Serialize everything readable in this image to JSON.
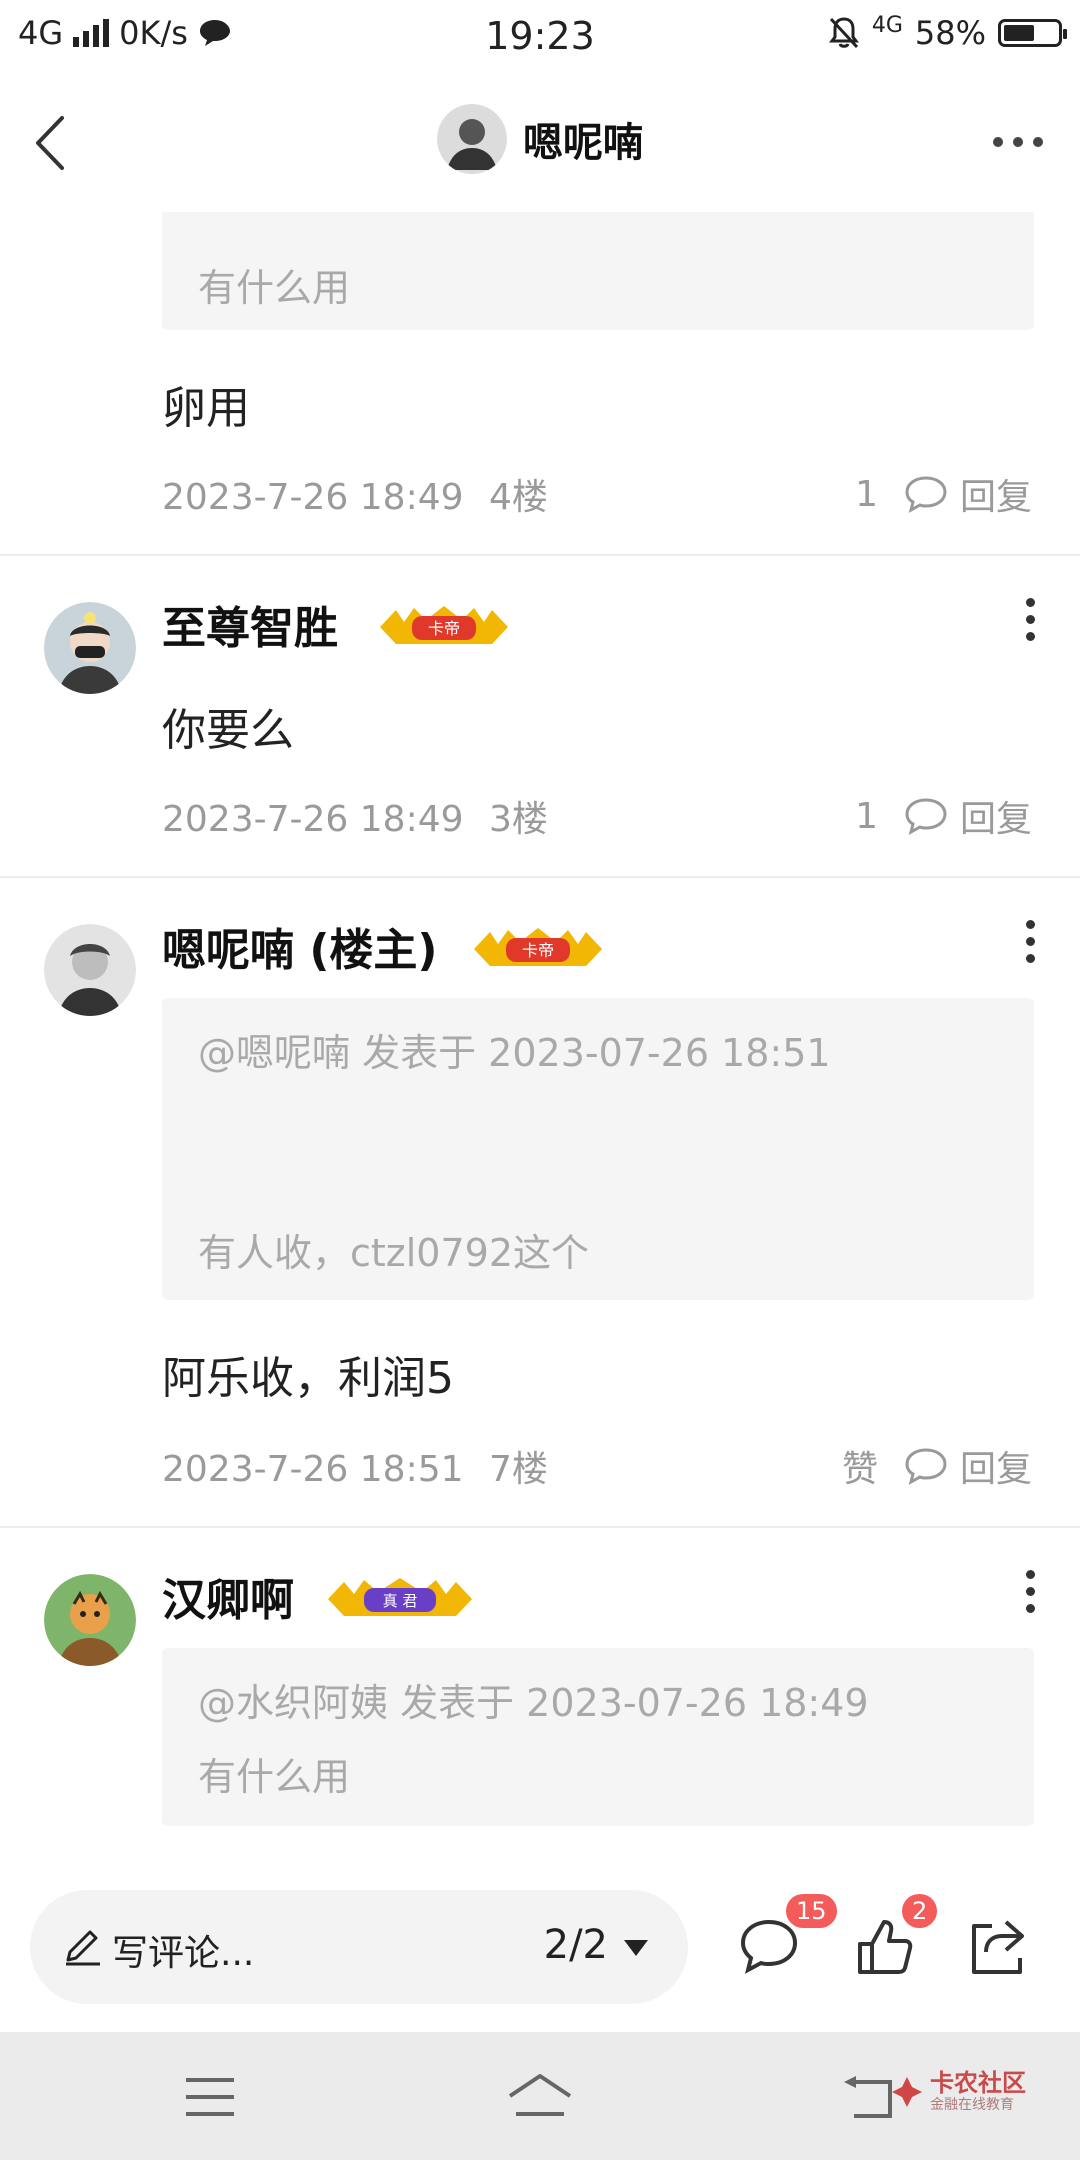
{
  "status_bar": {
    "network": "4G",
    "speed": "0K/s",
    "time": "19:23",
    "network_right": "4G",
    "battery": "58%",
    "battery_level": 0.58
  },
  "header": {
    "title": "嗯呢喃"
  },
  "posts": [
    {
      "quote_lines": [
        "有什么用"
      ],
      "text": "卵用",
      "date": "2023-7-26 18:49",
      "floor": "4楼",
      "likes": "1",
      "reply_label": "回复"
    },
    {
      "name": "至尊智胜",
      "badge": "卡帝",
      "text": "你要么",
      "date": "2023-7-26 18:49",
      "floor": "3楼",
      "likes": "1",
      "reply_label": "回复"
    },
    {
      "name": "嗯呢喃 (楼主)",
      "badge": "卡帝",
      "quote_lines": [
        "@嗯呢喃 发表于 2023-07-26 18:51",
        "有人收，ctzl0792这个"
      ],
      "text": "阿乐收，利润5",
      "date": "2023-7-26 18:51",
      "floor": "7楼",
      "likes": "赞",
      "reply_label": "回复"
    },
    {
      "name": "汉卿啊",
      "badge": "真 君",
      "quote_lines": [
        "@水织阿姨 发表于 2023-07-26 18:49",
        "有什么用"
      ]
    }
  ],
  "toolbar": {
    "comment_placeholder": "写评论...",
    "page": "2/2",
    "comment_count": "15",
    "like_count": "2"
  },
  "watermark": {
    "title": "卡农社区",
    "subtitle": "金融在线教育"
  },
  "colors": {
    "badge_red": "#e0392b",
    "badge_gold": "#f2b705",
    "badge_purple": "#6a3fc7",
    "count_red": "#f45c5c"
  }
}
